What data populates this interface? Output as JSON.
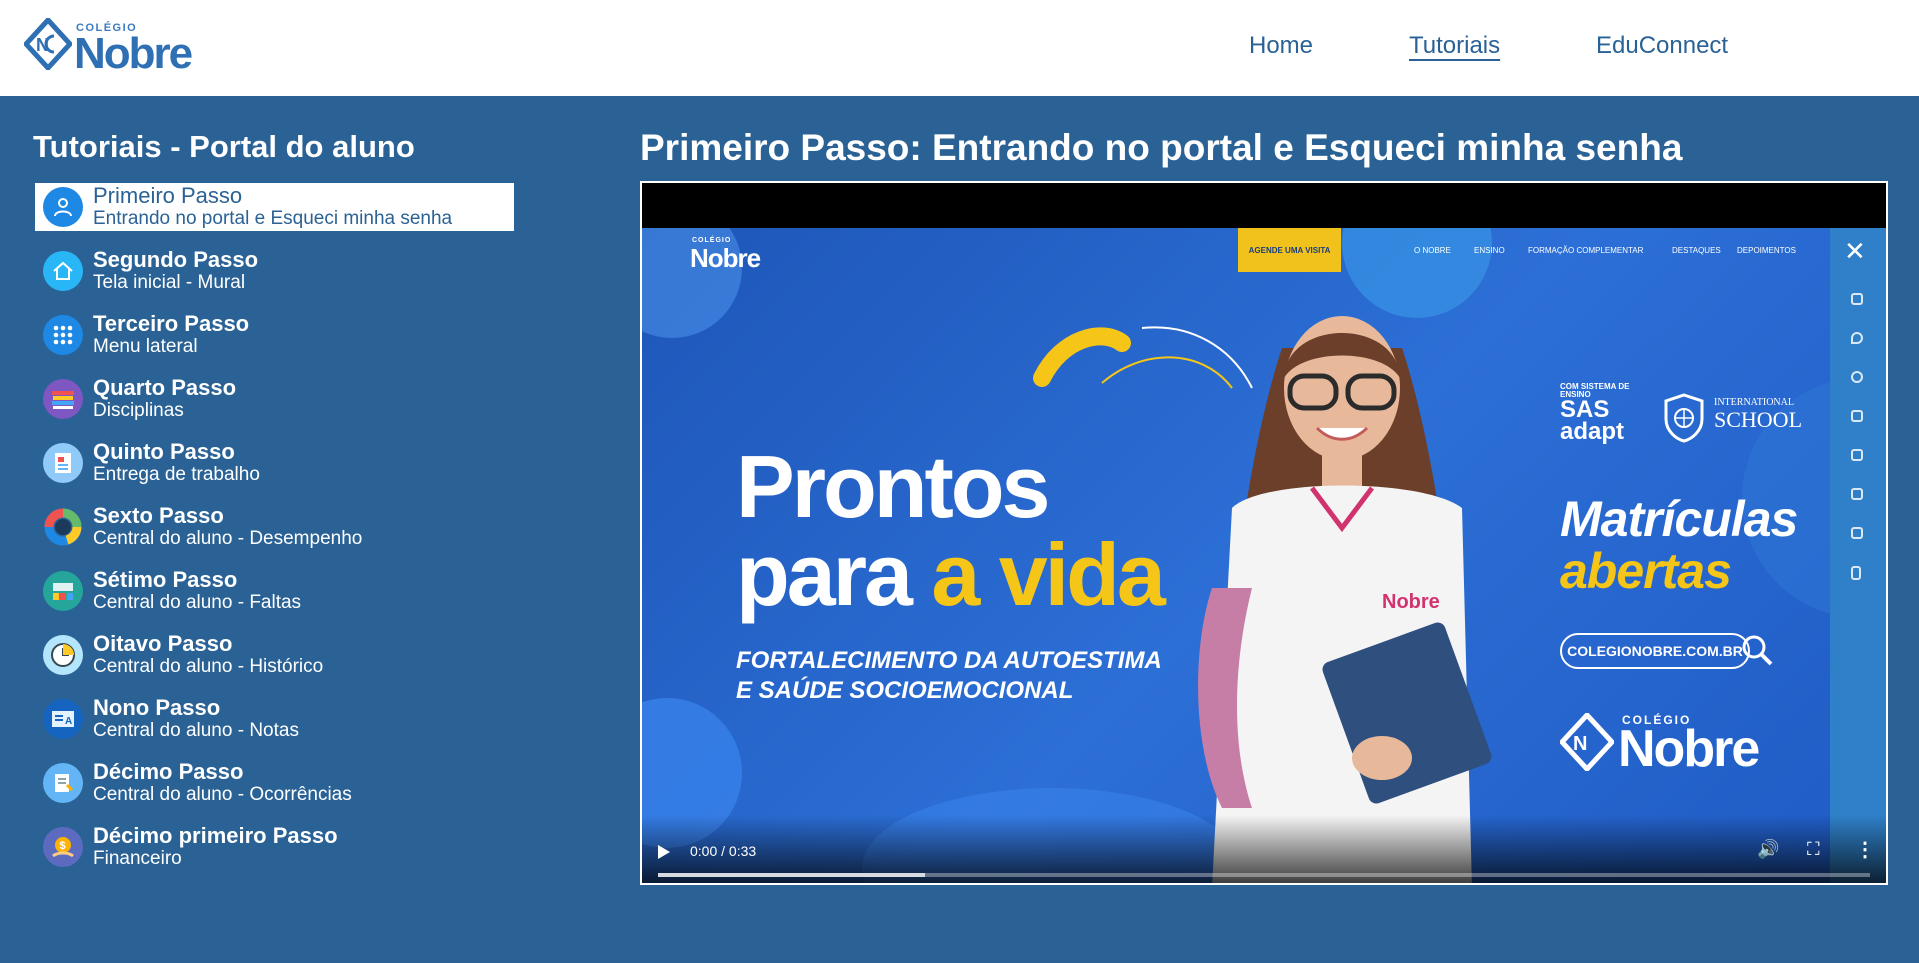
{
  "header": {
    "logo": {
      "small": "COLÉGIO",
      "big": "Nobre"
    },
    "nav": [
      {
        "label": "Home",
        "active": false
      },
      {
        "label": "Tutoriais",
        "active": true
      },
      {
        "label": "EduConnect",
        "active": false
      }
    ]
  },
  "sidebar": {
    "title": "Tutoriais - Portal do aluno",
    "steps": [
      {
        "title": "Primeiro Passo",
        "subtitle": "Entrando no portal e Esqueci minha senha",
        "icon": "user-icon",
        "active": true
      },
      {
        "title": "Segundo Passo",
        "subtitle": "Tela inicial - Mural",
        "icon": "home-icon",
        "active": false
      },
      {
        "title": "Terceiro Passo",
        "subtitle": "Menu lateral",
        "icon": "grid-icon",
        "active": false
      },
      {
        "title": "Quarto Passo",
        "subtitle": "Disciplinas",
        "icon": "books-icon",
        "active": false
      },
      {
        "title": "Quinto Passo",
        "subtitle": "Entrega de trabalho",
        "icon": "document-icon",
        "active": false
      },
      {
        "title": "Sexto Passo",
        "subtitle": "Central do aluno - Desempenho",
        "icon": "donut-chart-icon",
        "active": false
      },
      {
        "title": "Sétimo Passo",
        "subtitle": "Central do aluno - Faltas",
        "icon": "classroom-icon",
        "active": false
      },
      {
        "title": "Oitavo Passo",
        "subtitle": "Central do aluno - Histórico",
        "icon": "clock-icon",
        "active": false
      },
      {
        "title": "Nono Passo",
        "subtitle": "Central do aluno - Notas",
        "icon": "grades-icon",
        "active": false
      },
      {
        "title": "Décimo Passo",
        "subtitle": "Central do aluno - Ocorrências",
        "icon": "notebook-icon",
        "active": false
      },
      {
        "title": "Décimo primeiro Passo",
        "subtitle": "Financeiro",
        "icon": "money-icon",
        "active": false
      }
    ]
  },
  "main": {
    "title": "Primeiro Passo: Entrando no portal e Esqueci minha senha",
    "video": {
      "frame": {
        "logo_small": "COLÉGIO",
        "logo_big": "Nobre",
        "cta": "AGENDE UMA VISITA",
        "menu": [
          "O NOBRE",
          "ENSINO",
          "FORMAÇÃO COMPLEMENTAR",
          "DESTAQUES",
          "DEPOIMENTOS"
        ],
        "headline_1": "Prontos",
        "headline_2a": "para",
        "headline_2b": "a vida",
        "sub_1": "FORTALECIMENTO DA AUTOESTIMA",
        "sub_2": "E SAÚDE SOCIOEMOCIONAL",
        "sas_small": "COM SISTEMA DE ENSINO",
        "sas_big_1": "SAS",
        "sas_big_2": "adapt",
        "intl_small": "INTERNATIONAL",
        "intl_big": "SCHOOL",
        "matriculas_1": "Matrículas",
        "matriculas_2": "abertas",
        "site": "COLEGIONOBRE.COM.BR",
        "badge_text": "Nobre"
      },
      "time": "0:00 / 0:33",
      "progress": 0.22
    }
  },
  "colors": {
    "background": "#2a6296",
    "header": "#ffffff",
    "accent_yellow": "#f5c518"
  }
}
